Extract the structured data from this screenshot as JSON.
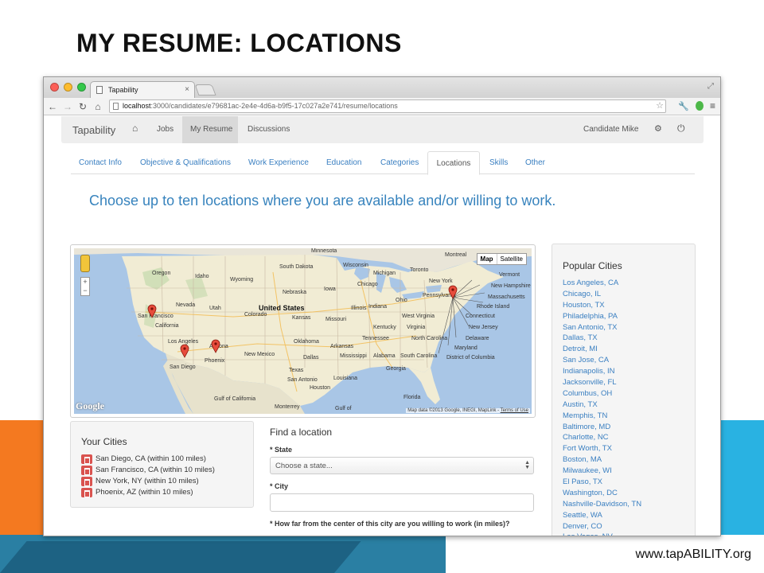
{
  "slide": {
    "title": "MY RESUME: LOCATIONS",
    "footer_url": "www.tapABILITY.org"
  },
  "browser": {
    "tab_title": "Tapability",
    "url_host": "localhost",
    "url_rest": ":3000/candidates/e79681ac-2e4e-4d6a-b9f5-17c027a2e741/resume/locations"
  },
  "navbar": {
    "brand": "Tapability",
    "links": [
      "Jobs",
      "My Resume",
      "Discussions"
    ],
    "user": "Candidate Mike"
  },
  "subtabs": [
    "Contact Info",
    "Objective & Qualifications",
    "Work Experience",
    "Education",
    "Categories",
    "Locations",
    "Skills",
    "Other"
  ],
  "headline": "Choose up to ten locations where you are available and/or willing to work.",
  "map": {
    "type_buttons": [
      "Map",
      "Satellite"
    ],
    "zoom_in": "+",
    "zoom_out": "−",
    "logo": "Google",
    "attribution": "Map data ©2013 Google, INEGI, MapLink - ",
    "terms": "Terms of Use",
    "country_label": "United States",
    "labels": [
      "Minnesota",
      "Montreal",
      "Wisconsin",
      "Oregon",
      "Idaho",
      "South Dakota",
      "Wyoming",
      "Michigan",
      "Toronto",
      "Vermont",
      "New Hampshire",
      "Massachusetts",
      "Rhode Island",
      "Connecticut",
      "New Jersey",
      "Delaware",
      "Maryland",
      "District of Columbia",
      "Iowa",
      "Chicago",
      "Nebraska",
      "New York",
      "Nevada",
      "Utah",
      "Colorado",
      "Ohio",
      "Pennsylvania",
      "Indiana",
      "Kansas",
      "Missouri",
      "Illinois",
      "West Virginia",
      "Virginia",
      "Kentucky",
      "Oklahoma",
      "Tennessee",
      "North Carolina",
      "South Carolina",
      "Arkansas",
      "Mississippi",
      "Alabama",
      "Georgia",
      "Texas",
      "Louisiana",
      "Dallas",
      "New Mexico",
      "Arizona",
      "Phoenix",
      "San Diego",
      "Los Angeles",
      "California",
      "San Francisco",
      "San Antonio",
      "Houston",
      "Florida",
      "Monterrey",
      "Gulf of California",
      "Gulf of"
    ]
  },
  "popular": {
    "heading": "Popular Cities",
    "cities": [
      "Los Angeles, CA",
      "Chicago, IL",
      "Houston, TX",
      "Philadelphia, PA",
      "San Antonio, TX",
      "Dallas, TX",
      "Detroit, MI",
      "San Jose, CA",
      "Indianapolis, IN",
      "Jacksonville, FL",
      "Columbus, OH",
      "Austin, TX",
      "Memphis, TN",
      "Baltimore, MD",
      "Charlotte, NC",
      "Fort Worth, TX",
      "Boston, MA",
      "Milwaukee, WI",
      "El Paso, TX",
      "Washington, DC",
      "Nashville-Davidson, TN",
      "Seattle, WA",
      "Denver, CO",
      "Las Vegas, NV"
    ]
  },
  "your_cities": {
    "heading": "Your Cities",
    "cities": [
      "San Diego, CA (within 100 miles)",
      "San Francisco, CA (within 10 miles)",
      "New York, NY (within 10 miles)",
      "Phoenix, AZ (within 10 miles)"
    ]
  },
  "find": {
    "heading": "Find a location",
    "state_label": "* State",
    "state_placeholder": "Choose a state...",
    "city_label": "* City",
    "city_value": "",
    "distance_label": "* How far from the center of this city are you willing to work (in miles)?"
  },
  "colors": {
    "accent_blue": "#3783bd",
    "link_blue": "#3a7fc1",
    "band_orange": "#f47920",
    "band_blue": "#29b2e2"
  }
}
